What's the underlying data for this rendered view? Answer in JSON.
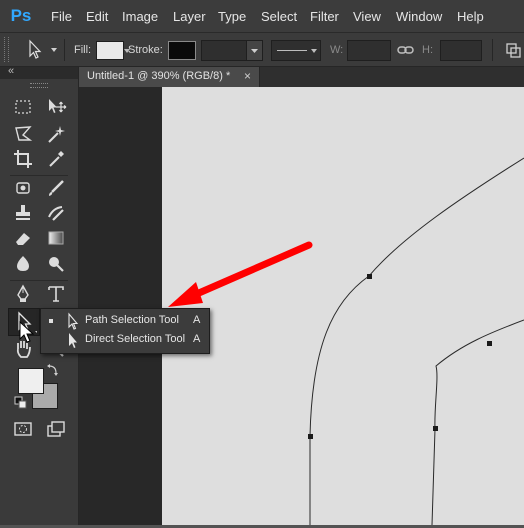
{
  "app": {
    "logo": "Ps"
  },
  "menu": [
    "File",
    "Edit",
    "Image",
    "Layer",
    "Type",
    "Select",
    "Filter",
    "View",
    "Window",
    "Help"
  ],
  "options": {
    "fill_label": "Fill:",
    "stroke_label": "Stroke:",
    "w_label": "W:",
    "h_label": "H:"
  },
  "toolbox": {
    "collapse_glyph": "«"
  },
  "document": {
    "tab_title": "Untitled-1 @ 390% (RGB/8) *",
    "tab_close": "×"
  },
  "flyout": {
    "items": [
      {
        "label": "Path Selection Tool",
        "shortcut": "A",
        "active": true
      },
      {
        "label": "Direct Selection Tool",
        "shortcut": "A",
        "active": false
      }
    ]
  },
  "colors": {
    "accent": "#31a8ff",
    "annotation_arrow": "#ff0000",
    "canvas": "#dedede",
    "ui_dark": "#3a3a3a"
  }
}
